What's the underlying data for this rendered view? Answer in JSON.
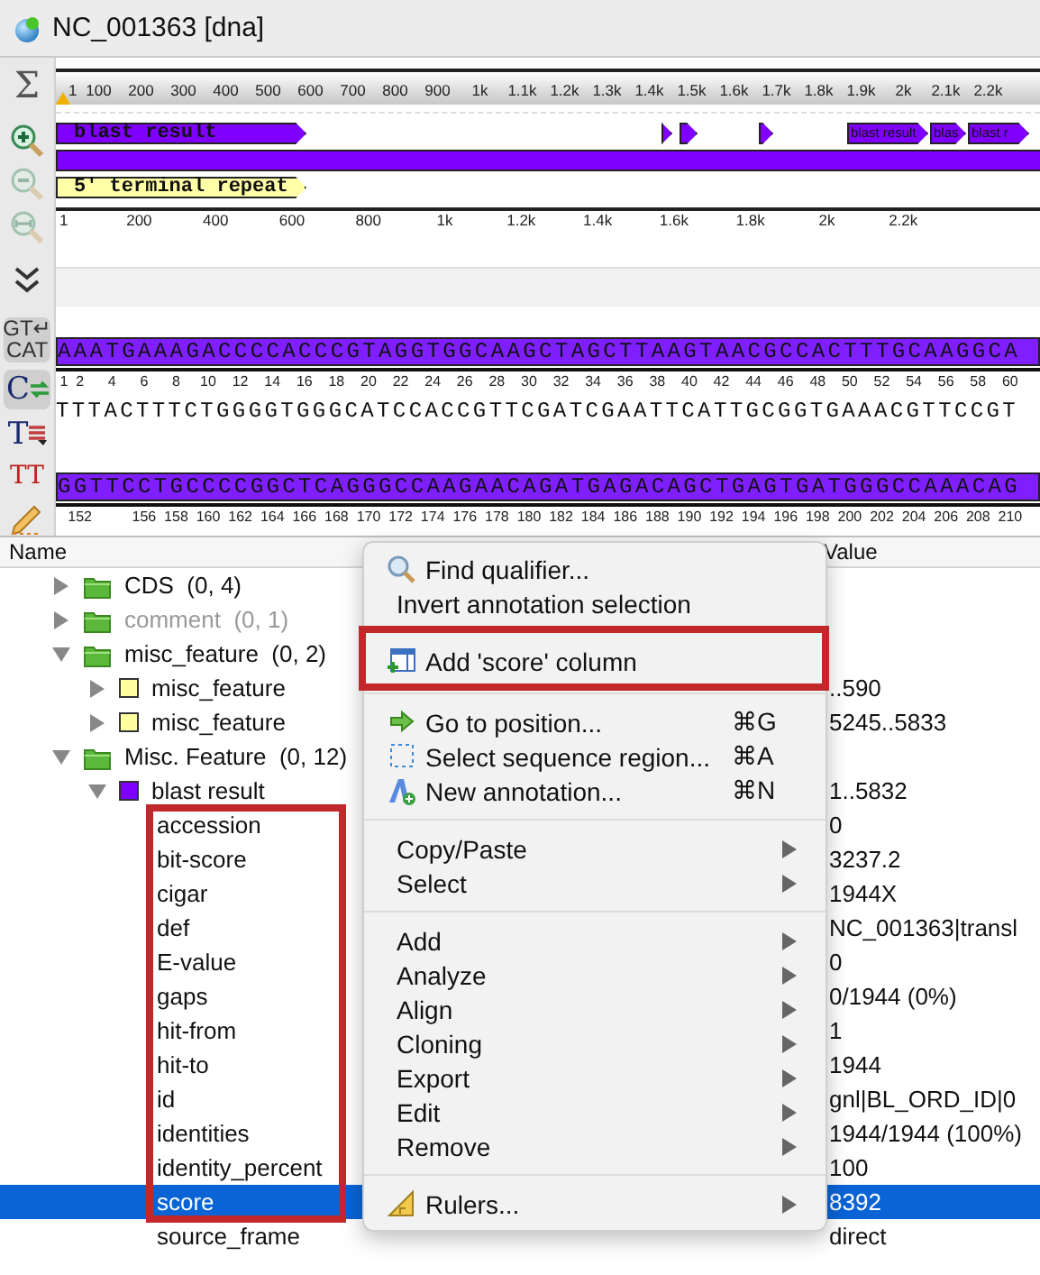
{
  "window": {
    "title": "NC_001363 [dna]"
  },
  "toolbar": [
    {
      "kind": "label",
      "text": "Σ",
      "on": false,
      "disabled": false
    },
    {
      "kind": "zoom_in",
      "on": false,
      "disabled": false
    },
    {
      "kind": "zoom_out",
      "on": false,
      "disabled": true
    },
    {
      "kind": "zoom_fit",
      "on": false,
      "disabled": true
    },
    {
      "kind": "chevrons",
      "on": false,
      "disabled": false
    },
    {
      "kind": "label",
      "text": "GT↵\nCAT",
      "on": true,
      "disabled": false
    },
    {
      "kind": "letter_arrows",
      "text": "C",
      "on": true,
      "disabled": false
    },
    {
      "kind": "letter_lines",
      "text": "T",
      "on": false,
      "disabled": false
    },
    {
      "kind": "letter_pair",
      "text": "TT",
      "on": false,
      "disabled": false
    },
    {
      "kind": "pencil",
      "on": false,
      "disabled": false
    }
  ],
  "overview_ruler": [
    "1",
    "100",
    "200",
    "300",
    "400",
    "500",
    "600",
    "700",
    "800",
    "900",
    "1k",
    "1.1k",
    "1.2k",
    "1.3k",
    "1.4k",
    "1.5k",
    "1.6k",
    "1.7k",
    "1.8k",
    "1.9k",
    "2k",
    "2.1k",
    "2.2k"
  ],
  "tracks": [
    [
      {
        "label": "blast result",
        "color": "#8000ff"
      },
      {
        "color": "#8000ff"
      },
      {
        "color": "#8000ff"
      },
      {
        "color": "#8000ff"
      },
      {
        "label": "blast result",
        "color": "#8000ff"
      },
      {
        "label": "blas",
        "color": "#8000ff"
      },
      {
        "label": "blast r",
        "color": "#8000ff"
      }
    ],
    [
      {
        "color": "#8000ff"
      }
    ],
    [
      {
        "label": "5' terminal repeat",
        "color": "#ffffa8"
      }
    ]
  ],
  "detail_ruler": [
    "1",
    "200",
    "400",
    "600",
    "800",
    "1k",
    "1.2k",
    "1.4k",
    "1.6k",
    "1.8k",
    "2k",
    "2.2k"
  ],
  "sequence_rows": [
    {
      "strand": "AAATGAAAGACCCCACCCGTAGGTGGCAAGCTAGCTTAAGTAACGCCACTTTGCAAGGCA",
      "positions": [
        "1",
        "2",
        "4",
        "6",
        "8",
        "10",
        "12",
        "14",
        "16",
        "18",
        "20",
        "22",
        "24",
        "26",
        "28",
        "30",
        "32",
        "34",
        "36",
        "38",
        "40",
        "42",
        "44",
        "46",
        "48",
        "50",
        "52",
        "54",
        "56",
        "58",
        "60"
      ],
      "complement": "TTTACTTTCTGGGGTGGGCATCCACCGTTCGATCGAATTCATTGCGGTGAAACGTTCCGT"
    },
    {
      "strand": "GGTTCCTGCCCCGGCTCAGGGCCAAGAACAGATGAGACAGCTGAGTGATGGGCCAAACAG",
      "positions": [
        "152",
        "156",
        "158",
        "160",
        "162",
        "164",
        "166",
        "168",
        "170",
        "172",
        "174",
        "176",
        "178",
        "180",
        "182",
        "184",
        "186",
        "188",
        "190",
        "192",
        "194",
        "196",
        "198",
        "200",
        "202",
        "204",
        "206",
        "208",
        "210"
      ]
    }
  ],
  "tree": {
    "columns": [
      "Name",
      "Value"
    ],
    "groups": [
      {
        "name": "CDS",
        "count": "(0, 4)",
        "expanded": false,
        "disabled": false
      },
      {
        "name": "comment",
        "count": "(0, 1)",
        "expanded": false,
        "disabled": true
      },
      {
        "name": "misc_feature",
        "count": "(0, 2)",
        "expanded": true,
        "disabled": false,
        "children": [
          {
            "name": "misc_feature",
            "color": "#ffffa0",
            "value": "..590",
            "expanded": false
          },
          {
            "name": "misc_feature",
            "color": "#ffffa0",
            "value": "5245..5833",
            "expanded": false
          }
        ]
      },
      {
        "name": "Misc. Feature",
        "count": "(0, 12)",
        "expanded": true,
        "disabled": false,
        "children": [
          {
            "name": "blast result",
            "color": "#7f00ff",
            "value": "1..5832",
            "expanded": true,
            "qualifiers_framed": true,
            "qualifiers": [
              {
                "name": "accession",
                "value": "0",
                "selected": false
              },
              {
                "name": "bit-score",
                "value": "3237.2",
                "selected": false
              },
              {
                "name": "cigar",
                "value": "1944X",
                "selected": false
              },
              {
                "name": "def",
                "value": "NC_001363|transl",
                "selected": false
              },
              {
                "name": "E-value",
                "value": "0",
                "selected": false
              },
              {
                "name": "gaps",
                "value": "0/1944 (0%)",
                "selected": false
              },
              {
                "name": "hit-from",
                "value": "1",
                "selected": false
              },
              {
                "name": "hit-to",
                "value": "1944",
                "selected": false
              },
              {
                "name": "id",
                "value": "gnl|BL_ORD_ID|0",
                "selected": false
              },
              {
                "name": "identities",
                "value": "1944/1944 (100%)",
                "selected": false
              },
              {
                "name": "identity_percent",
                "value": "100",
                "selected": false
              },
              {
                "name": "score",
                "value": "8392",
                "selected": true
              },
              {
                "name": "source_frame",
                "value": "direct",
                "selected": false
              }
            ]
          }
        ]
      }
    ]
  },
  "context_menu": [
    {
      "kind": "search",
      "label": "Find qualifier..."
    },
    {
      "kind": "plain",
      "label": "Invert annotation selection"
    },
    {
      "kind": "separator"
    },
    {
      "kind": "add_column",
      "label": "Add 'score' column",
      "framed": true
    },
    {
      "kind": "separator"
    },
    {
      "kind": "goto",
      "label": "Go to position...",
      "shortcut": "⌘G"
    },
    {
      "kind": "select_region",
      "label": "Select sequence region...",
      "shortcut": "⌘A"
    },
    {
      "kind": "new_annotation",
      "label": "New annotation...",
      "shortcut": "⌘N"
    },
    {
      "kind": "separator"
    },
    {
      "kind": "plain",
      "label": "Copy/Paste",
      "submenu": true
    },
    {
      "kind": "plain",
      "label": "Select",
      "submenu": true
    },
    {
      "kind": "separator"
    },
    {
      "kind": "plain",
      "label": "Add",
      "submenu": true
    },
    {
      "kind": "plain",
      "label": "Analyze",
      "submenu": true
    },
    {
      "kind": "plain",
      "label": "Align",
      "submenu": true
    },
    {
      "kind": "plain",
      "label": "Cloning",
      "submenu": true
    },
    {
      "kind": "plain",
      "label": "Export",
      "submenu": true
    },
    {
      "kind": "plain",
      "label": "Edit",
      "submenu": true
    },
    {
      "kind": "plain",
      "label": "Remove",
      "submenu": true
    },
    {
      "kind": "separator"
    },
    {
      "kind": "rulers",
      "label": "Rulers...",
      "submenu": true
    }
  ]
}
